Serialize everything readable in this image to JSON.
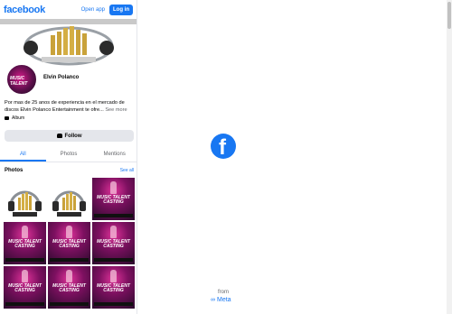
{
  "header": {
    "logo": "facebook",
    "open_app": "Open app",
    "login": "Log in"
  },
  "profile": {
    "avatar_text": "MUSIC TALENT",
    "name": "Elvin Polanco",
    "bio": "Por mas de 25 anos de experiencia en el mercado de discos Elvin Polanco Entertainment te ofre...",
    "see_more": "See more",
    "category": "Album",
    "follow": "Follow"
  },
  "tabs": [
    "All",
    "Photos",
    "Mentions"
  ],
  "photos": {
    "title": "Photos",
    "see_all": "See all",
    "items": [
      {
        "kind": "logo"
      },
      {
        "kind": "logo"
      },
      {
        "kind": "poster",
        "title": "MUSIC TALENT CASTING"
      },
      {
        "kind": "poster",
        "title": "MUSIC TALENT CASTING"
      },
      {
        "kind": "poster",
        "title": "MUSIC TALENT CASTING"
      },
      {
        "kind": "poster",
        "title": "MUSIC TALENT CASTING"
      },
      {
        "kind": "poster",
        "title": "MUSIC TALENT CASTING"
      },
      {
        "kind": "poster",
        "title": "MUSIC TALENT CASTING"
      },
      {
        "kind": "poster",
        "title": "MUSIC TALENT CASTING"
      }
    ]
  },
  "splash": {
    "logo_letter": "f",
    "from": "from",
    "meta": "Meta"
  },
  "colors": {
    "brand": "#1877f2",
    "poster": "#c2187d"
  }
}
